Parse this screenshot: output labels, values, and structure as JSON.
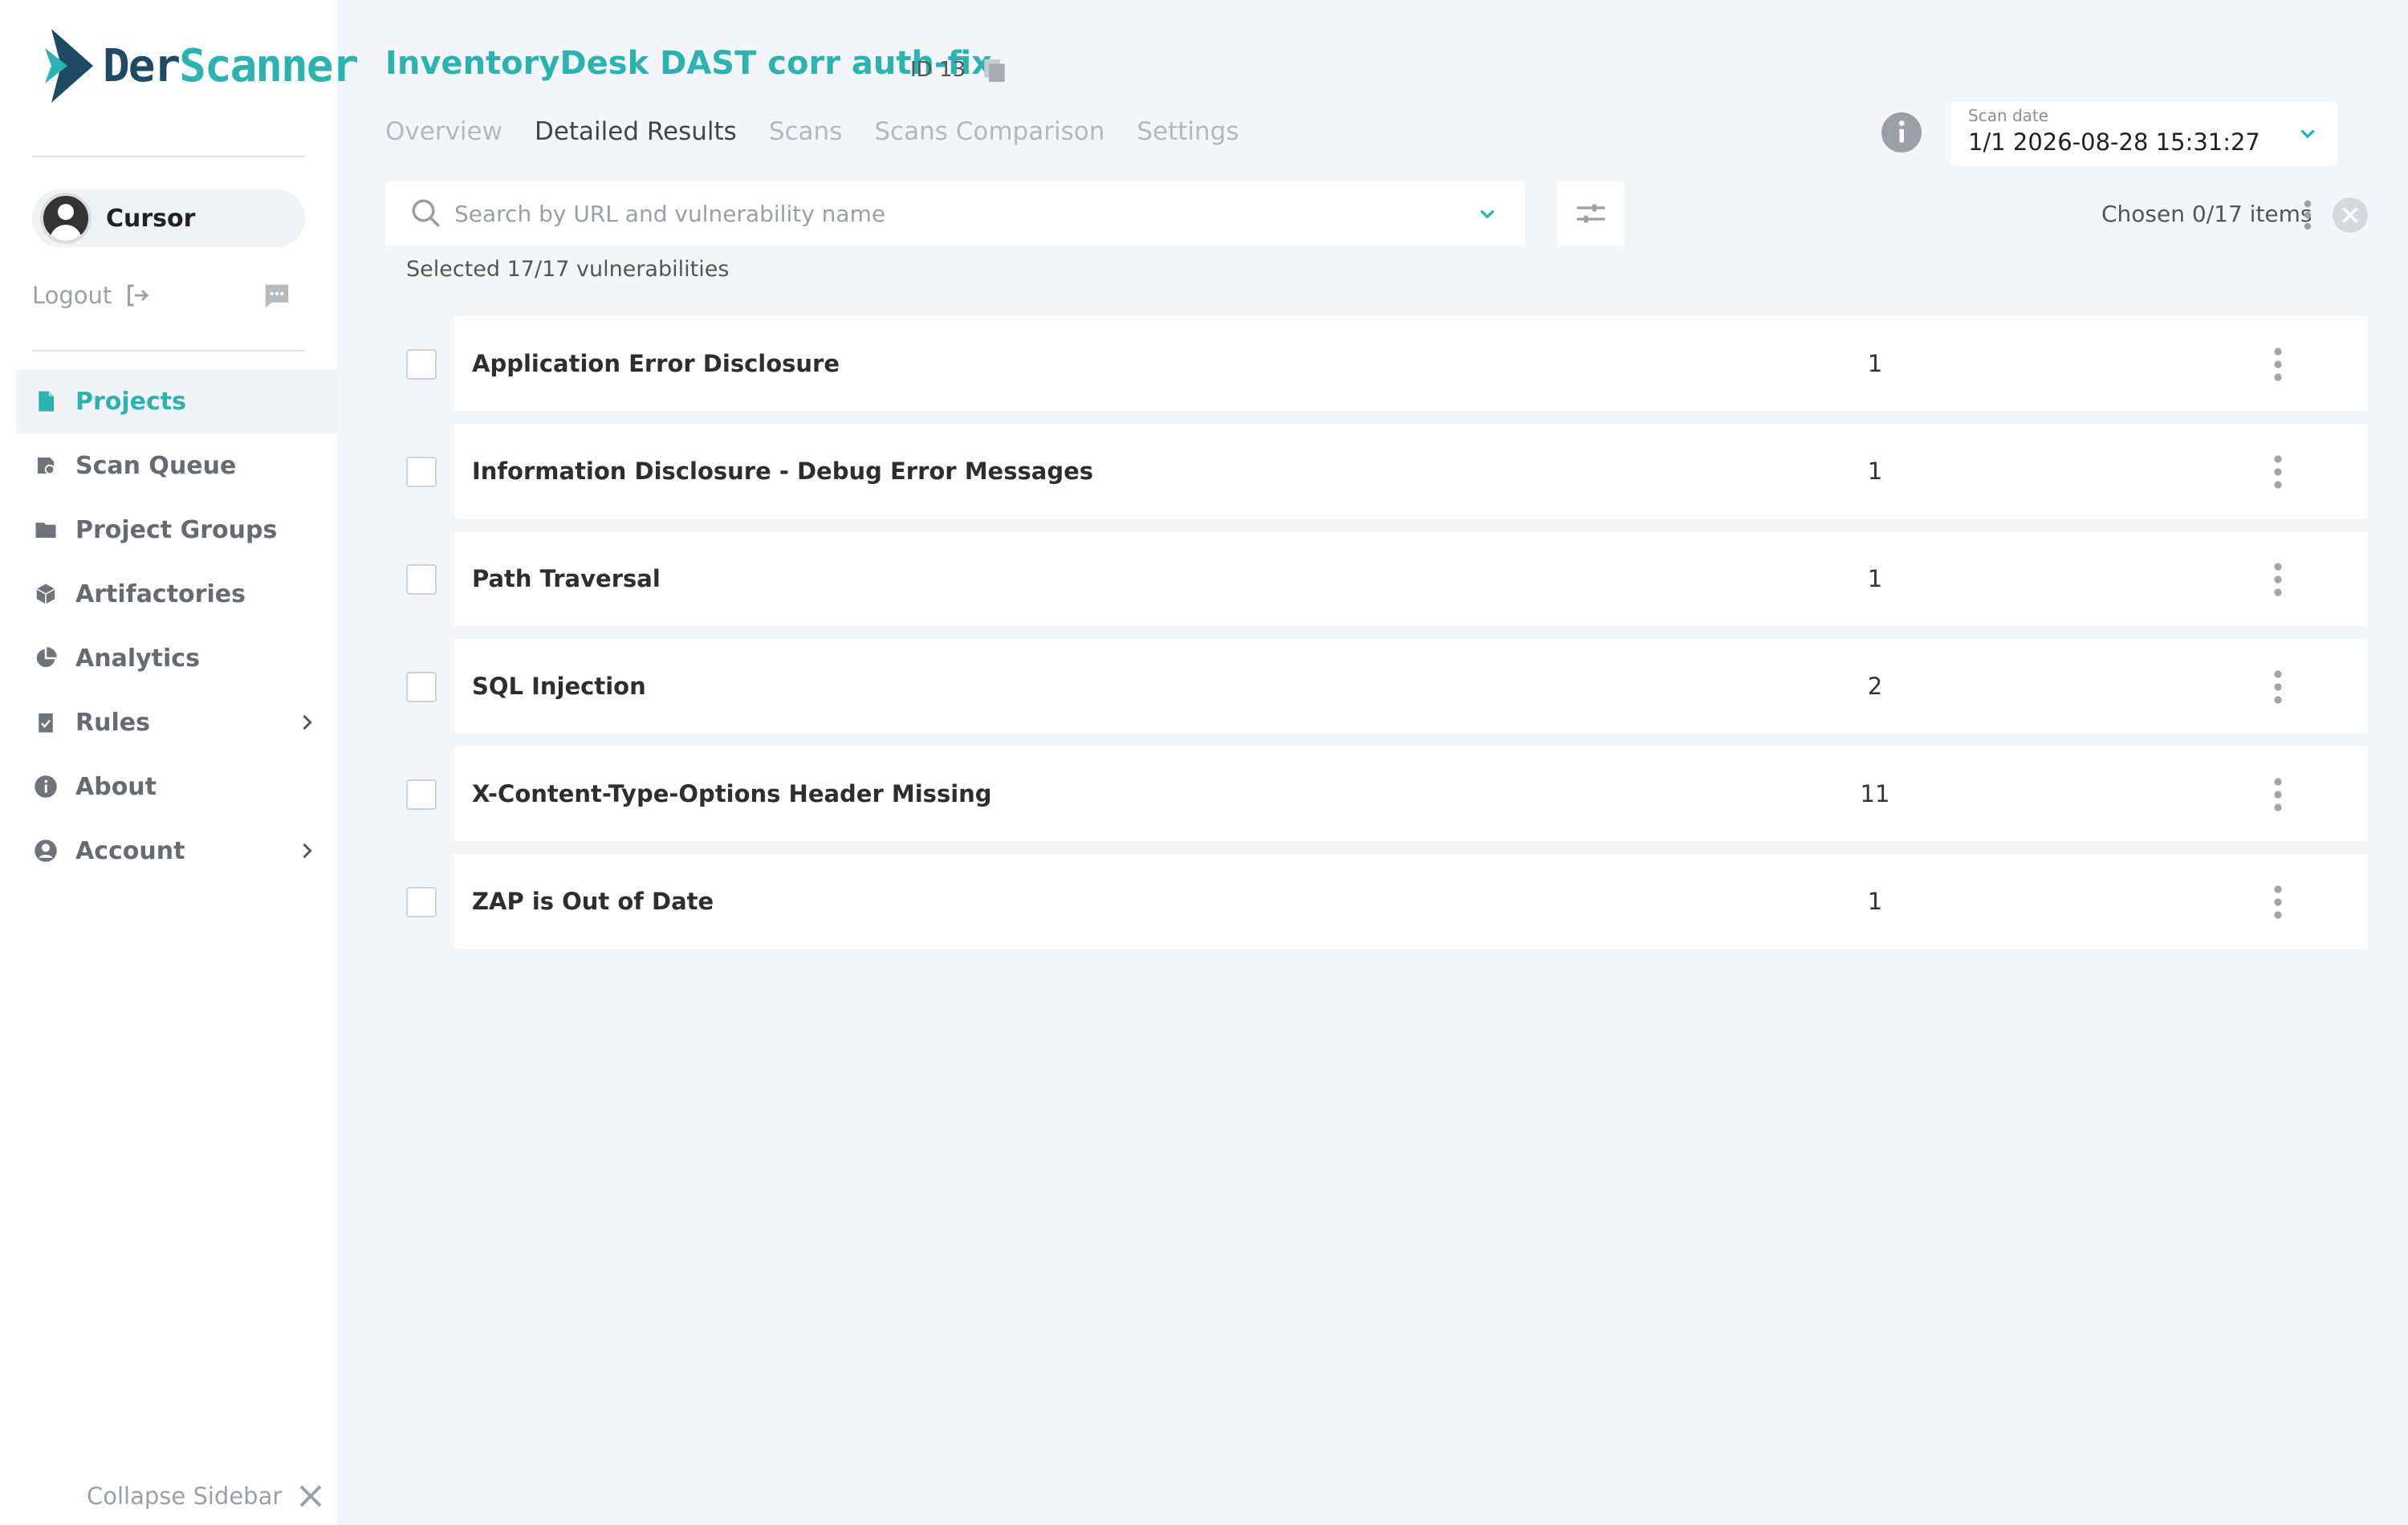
{
  "brand": {
    "logo_part1": "Der",
    "logo_part2": "Scanner",
    "colors": {
      "accent": "#2ab3b1",
      "dark": "#1e4a63"
    }
  },
  "user": {
    "name": "Cursor"
  },
  "sidebar": {
    "logout_label": "Logout",
    "items": [
      {
        "label": "Projects",
        "icon": "document-icon",
        "active": true
      },
      {
        "label": "Scan Queue",
        "icon": "queue-icon"
      },
      {
        "label": "Project Groups",
        "icon": "folder-icon"
      },
      {
        "label": "Artifactories",
        "icon": "cube-icon"
      },
      {
        "label": "Analytics",
        "icon": "pie-chart-icon"
      },
      {
        "label": "Rules",
        "icon": "clipboard-check-icon",
        "expandable": true
      },
      {
        "label": "About",
        "icon": "info-icon"
      },
      {
        "label": "Account",
        "icon": "user-circle-icon",
        "expandable": true
      }
    ],
    "collapse_label": "Collapse Sidebar"
  },
  "project": {
    "title": "InventoryDesk DAST corr auth-fix",
    "id_label": "ID 13"
  },
  "tabs": [
    {
      "label": "Overview"
    },
    {
      "label": "Detailed Results",
      "active": true
    },
    {
      "label": "Scans"
    },
    {
      "label": "Scans Comparison"
    },
    {
      "label": "Settings"
    }
  ],
  "scan_date": {
    "label": "Scan date",
    "value": "1/1 2026-08-28 15:31:27"
  },
  "search": {
    "placeholder": "Search by URL and vulnerability name",
    "value": ""
  },
  "chosen_label": "Chosen 0/17 items",
  "selected_label": "Selected 17/17 vulnerabilities",
  "vulnerabilities": [
    {
      "name": "Application Error Disclosure",
      "count": "1"
    },
    {
      "name": "Information Disclosure - Debug Error Messages",
      "count": "1"
    },
    {
      "name": "Path Traversal",
      "count": "1"
    },
    {
      "name": "SQL Injection",
      "count": "2"
    },
    {
      "name": "X-Content-Type-Options Header Missing",
      "count": "11"
    },
    {
      "name": "ZAP is Out of Date",
      "count": "1"
    }
  ]
}
